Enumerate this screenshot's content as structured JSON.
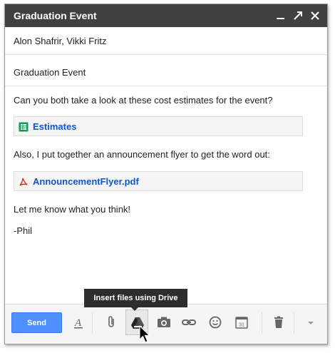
{
  "window": {
    "title": "Graduation Event"
  },
  "compose": {
    "to": "Alon Shafrir, Vikki Fritz",
    "subject": "Graduation Event",
    "body": {
      "line1": "Can you both take a look at these cost estimates for the event?",
      "attachment1": "Estimates",
      "line2": "Also, I put together an announcement flyer to get the word out:",
      "attachment2": "AnnouncementFlyer.pdf",
      "line3": "Let me know what you think!",
      "signature": "-Phil"
    }
  },
  "toolbar": {
    "send_label": "Send",
    "tooltip": "Insert files using Drive",
    "calendar_day": "31"
  },
  "icons": [
    "minimize-icon",
    "popout-icon",
    "close-icon",
    "sheets-icon",
    "pdf-icon",
    "formatting-icon",
    "attach-icon",
    "drive-icon",
    "camera-icon",
    "link-icon",
    "emoji-icon",
    "calendar-icon",
    "trash-icon",
    "more-options-icon"
  ],
  "colors": {
    "titlebar": "#404040",
    "send": "#4d90fe",
    "link": "#1155cc",
    "sheets": "#0f9d58",
    "pdf": "#d93025"
  }
}
